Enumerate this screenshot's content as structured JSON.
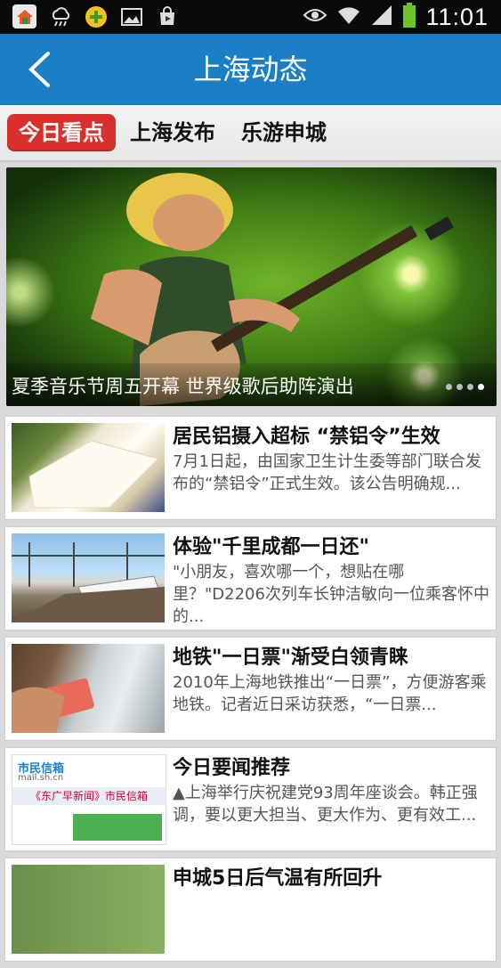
{
  "status_bar": {
    "time": "11:01",
    "left_icons": [
      "home-icon",
      "cloud-rain-icon",
      "plus-circle-icon",
      "image-icon",
      "store-icon"
    ],
    "right_icons": [
      "eye-icon",
      "wifi-icon",
      "signal-icon",
      "battery-icon"
    ]
  },
  "header": {
    "title": "上海动态",
    "background": "#1b7fc6"
  },
  "tabs": [
    {
      "label": "今日看点",
      "active": true
    },
    {
      "label": "上海发布",
      "active": false
    },
    {
      "label": "乐游申城",
      "active": false
    }
  ],
  "accent_color": "#d8302c",
  "hero": {
    "title": "夏季音乐节周五开幕 世界级歌后助阵演出",
    "dots": 4,
    "active_dot": 4
  },
  "news": [
    {
      "title": "居民铝摄入超标 “禁铝令”生效",
      "summary": "7月1日起，由国家卫生计生委等部门联合发布的“禁铝令”正式生效。该公告明确规..."
    },
    {
      "title": "体验\"千里成都一日还\"",
      "summary": "\"小朋友，喜欢哪一个，想贴在哪里？\"D2206次列车长钟洁敏向一位乘客怀中的..."
    },
    {
      "title": "地铁\"一日票\"渐受白领青睐",
      "summary": "2010年上海地铁推出“一日票”，方便游客乘地铁。记者近日采访获悉，“一日票..."
    },
    {
      "title": "今日要闻推荐",
      "summary": "▲上海举行庆祝建党93周年座谈会。韩正强调，要以更大担当、更大作为、更有效工...",
      "thumb_text": [
        "市民信箱",
        "mail.sh.cn",
        "《东广早新闻》市民信箱"
      ]
    },
    {
      "title": "申城5日后气温有所回升",
      "summary": ""
    }
  ]
}
